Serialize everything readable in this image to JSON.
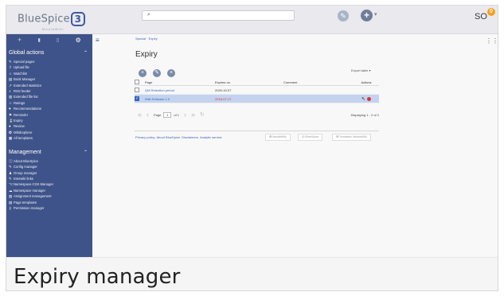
{
  "header": {
    "logo_text": "BlueSpice",
    "logo_number": "3",
    "logo_sub": "MediaWiki",
    "search_icon": "⌕",
    "user_initials": "SO",
    "notification_count": "0"
  },
  "sidebar": {
    "global_title": "Global actions",
    "global_items": [
      {
        "icon": "✎",
        "label": "Special pages"
      },
      {
        "icon": "⇪",
        "label": "Upload file"
      },
      {
        "icon": "☆",
        "label": "Watchlist"
      },
      {
        "icon": "▤",
        "label": "Book Manager"
      },
      {
        "icon": "↗",
        "label": "Extended statistics"
      },
      {
        "icon": "◗",
        "label": "RSS feeder"
      },
      {
        "icon": "▥",
        "label": "Extended file list"
      },
      {
        "icon": "☆",
        "label": "Ratings"
      },
      {
        "icon": "♥",
        "label": "Recommendations"
      },
      {
        "icon": "⚑",
        "label": "Reminder"
      },
      {
        "icon": "⌛",
        "label": "Expiry"
      },
      {
        "icon": "●",
        "label": "Review"
      },
      {
        "icon": "✪",
        "label": "WikiExplorer"
      },
      {
        "icon": "▦",
        "label": "All templates"
      }
    ],
    "management_title": "Management",
    "management_items": [
      {
        "icon": "ⓘ",
        "label": "About BlueSpice"
      },
      {
        "icon": "✎",
        "label": "Config manager"
      },
      {
        "icon": "♟",
        "label": "Group manager"
      },
      {
        "icon": "✎",
        "label": "Interwiki links"
      },
      {
        "icon": "⌥",
        "label": "Namespace-CSS Manager"
      },
      {
        "icon": "☁",
        "label": "Namespace manager"
      },
      {
        "icon": "▥",
        "label": "Assignment management"
      },
      {
        "icon": "▤",
        "label": "Page templates"
      },
      {
        "icon": "⚷",
        "label": "Permission manager"
      }
    ]
  },
  "main": {
    "breadcrumb": "Special · Expiry",
    "title": "Expiry",
    "export_label": "Export table",
    "columns": [
      "Page",
      "Expires on",
      "Comment",
      "Actions"
    ],
    "rows": [
      {
        "page": "QM Retention period",
        "expires": "2020-10-07",
        "comment": "",
        "selected": false,
        "overdue": false
      },
      {
        "page": "Wiki Software 1.0",
        "expires": "2018-07-17",
        "comment": "",
        "selected": true,
        "overdue": true
      }
    ],
    "pager": {
      "page_label": "Page",
      "page_value": "1",
      "of_label": "of 1",
      "display_text": "Displaying 1 - 2 of 2"
    },
    "footer_links": [
      "Privacy policy",
      "About BlueSpice",
      "Disclaimers",
      "Analytic service"
    ],
    "footer_badges": [
      "MediaWiki",
      "BlueSpice",
      "Semantic MediaWiki"
    ]
  },
  "caption": "Expiry manager",
  "colors": {
    "sidebar": "#3e5389",
    "accent": "#3a63b8",
    "badge": "#f7a01d",
    "overdue": "#dd3333"
  }
}
